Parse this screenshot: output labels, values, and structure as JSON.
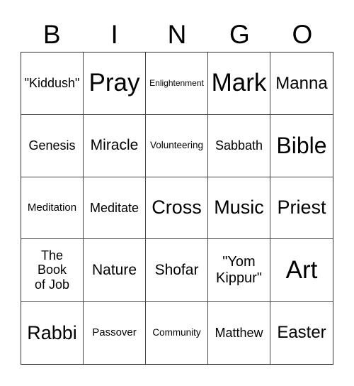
{
  "header": [
    "B",
    "I",
    "N",
    "G",
    "O"
  ],
  "cells": [
    "\"Kiddush\"",
    "Pray",
    "Enlightenment",
    "Mark",
    "Manna",
    "Genesis",
    "Miracle",
    "Volunteering",
    "Sabbath",
    "Bible",
    "Meditation",
    "Meditate",
    "Cross",
    "Music",
    "Priest",
    "The Book of Job",
    "Nature",
    "Shofar",
    "\"Yom Kippur\"",
    "Art",
    "Rabbi",
    "Passover",
    "Community",
    "Matthew",
    "Easter"
  ]
}
